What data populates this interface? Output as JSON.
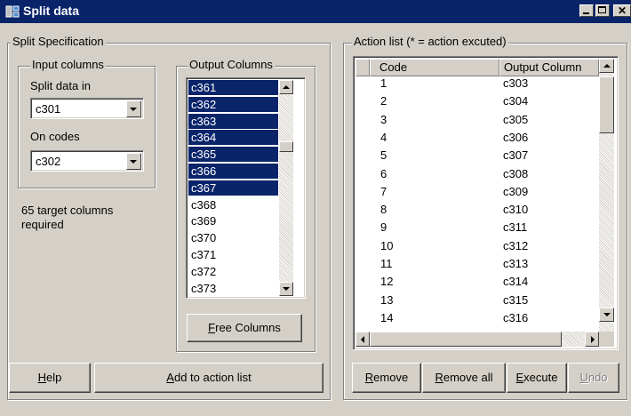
{
  "window": {
    "title": "Split data"
  },
  "split_spec": {
    "title": "Split Specification",
    "input_columns": {
      "title": "Input columns",
      "split_label": "Split data in",
      "split_value": "c301",
      "codes_label": "On codes",
      "codes_value": "c302"
    },
    "output_columns": {
      "title": "Output Columns",
      "items": [
        "c361",
        "c362",
        "c363",
        "c364",
        "c365",
        "c366",
        "c367",
        "c368",
        "c369",
        "c370",
        "c371",
        "c372",
        "c373"
      ],
      "selected_count": 7
    },
    "target_text": "65 target columns required",
    "free_columns_label": "Free Columns",
    "help_label": "Help",
    "add_label": "Add to action list"
  },
  "action_list": {
    "title": "Action list (* = action excuted)",
    "headers": {
      "code": "Code",
      "output": "Output Column"
    },
    "rows": [
      [
        "1",
        "c303"
      ],
      [
        "2",
        "c304"
      ],
      [
        "3",
        "c305"
      ],
      [
        "4",
        "c306"
      ],
      [
        "5",
        "c307"
      ],
      [
        "6",
        "c308"
      ],
      [
        "7",
        "c309"
      ],
      [
        "8",
        "c310"
      ],
      [
        "9",
        "c311"
      ],
      [
        "10",
        "c312"
      ],
      [
        "11",
        "c313"
      ],
      [
        "12",
        "c314"
      ],
      [
        "13",
        "c315"
      ],
      [
        "14",
        "c316"
      ]
    ],
    "buttons": {
      "remove": "Remove",
      "remove_all": "Remove all",
      "execute": "Execute",
      "undo": "Undo"
    }
  },
  "colors": {
    "face": "#d4d0c8",
    "selection": "#0a246a",
    "titlebar": "#0a246a"
  },
  "icons": {
    "app": "split-data-app-icon",
    "minimize": "minimize-icon",
    "maximize": "maximize-icon",
    "close": "close-icon"
  }
}
